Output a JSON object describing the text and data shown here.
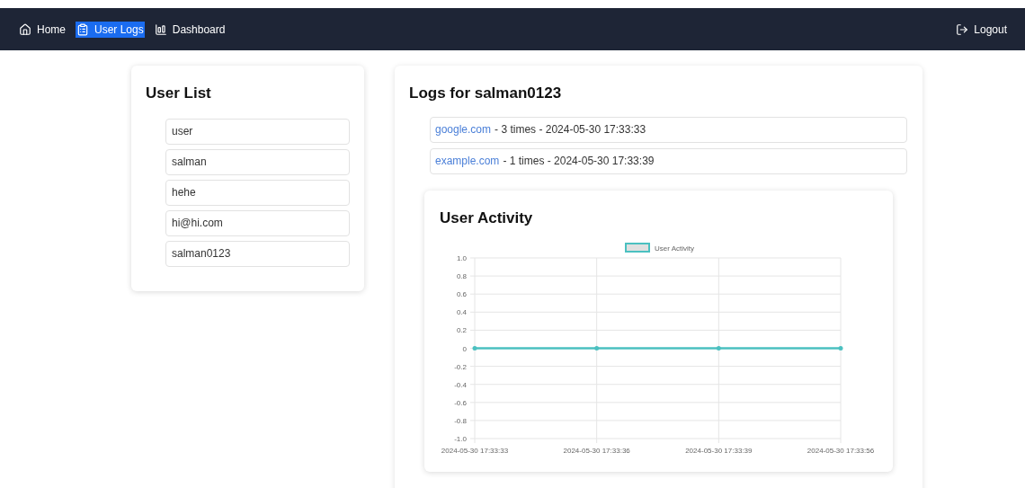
{
  "nav": {
    "items": [
      {
        "label": "Home",
        "kind": "home",
        "selected": false
      },
      {
        "label": "User Logs",
        "kind": "logs",
        "selected": true
      },
      {
        "label": "Dashboard",
        "kind": "dashboard",
        "selected": false
      }
    ],
    "logout": "Logout"
  },
  "user_list": {
    "title": "User List",
    "users": [
      "user",
      "salman",
      "hehe",
      "hi@hi.com",
      "salman0123"
    ]
  },
  "logs": {
    "title": "Logs for salman0123",
    "entries": [
      {
        "site": "google.com",
        "details": "- 3 times - 2024-05-30 17:33:33"
      },
      {
        "site": "example.com",
        "details": "- 1 times - 2024-05-30 17:33:39"
      }
    ]
  },
  "activity": {
    "title": "User Activity",
    "chart_data": {
      "type": "line",
      "categories": [
        "2024-05-30 17:33:33",
        "2024-05-30 17:33:36",
        "2024-05-30 17:33:39",
        "2024-05-30 17:33:56"
      ],
      "series": [
        {
          "name": "User Activity",
          "color": "#4bc0c0",
          "values": [
            0,
            0,
            0,
            0
          ]
        }
      ],
      "grid": true,
      "ylim": [
        -1,
        1
      ],
      "yticks": [
        {
          "value": 1,
          "label": "1.0"
        },
        {
          "value": 0.8,
          "label": "0.8"
        },
        {
          "value": 0.6,
          "label": "0.6"
        },
        {
          "value": 0.4,
          "label": "0.4"
        },
        {
          "value": 0.2,
          "label": "0.2"
        },
        {
          "value": 0,
          "label": "0"
        },
        {
          "value": -0.2,
          "label": "-0.2"
        },
        {
          "value": -0.4,
          "label": "-0.4"
        },
        {
          "value": -0.6,
          "label": "-0.6"
        },
        {
          "value": -0.8,
          "label": "-0.8"
        },
        {
          "value": -1,
          "label": "-1.0"
        }
      ]
    }
  }
}
